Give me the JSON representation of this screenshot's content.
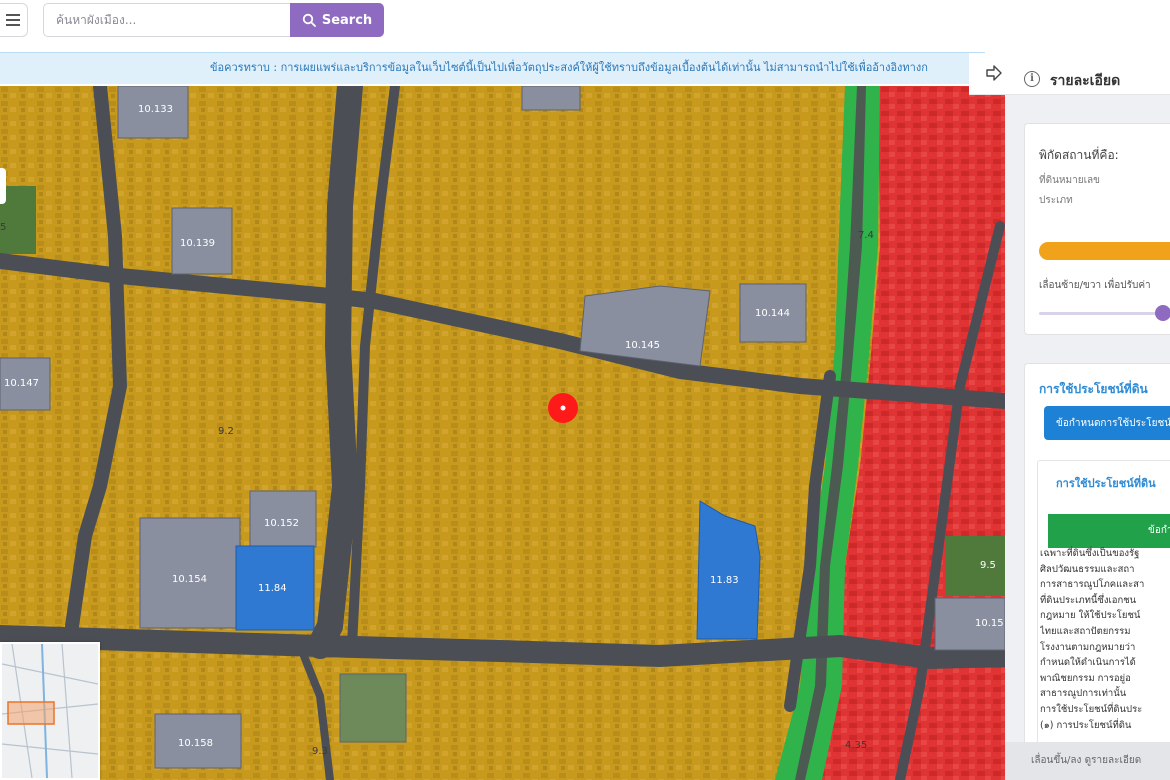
{
  "toolbar": {
    "menu_icon": "hamburger-icon",
    "search_placeholder": "ค้นหาผังเมือง...",
    "search_label": "Search",
    "search_icon": "search-icon"
  },
  "notice": {
    "text": "ข้อควรทราบ : การเผยแพร่และบริการข้อมูลในเว็บไซต์นี้เป็นไปเพื่อวัตถุประสงค์ให้ผู้ใช้ทราบถึงข้อมูลเบื้องต้นได้เท่านั้น ไม่สามารถนำไปใช้เพื่ออ้างอิงทางก"
  },
  "map": {
    "zone_colors": {
      "residential_dense": "#c79a1e",
      "commercial": "#e03333",
      "green_belt": "#2fb34a",
      "government": "#8a8fa0",
      "institutional": "#2f79d2",
      "park": "#4f7a3b"
    },
    "marker_color": "#ff1a1a",
    "parcel_labels": [
      "10.133",
      "10.139",
      "10.145",
      "10.144",
      "10.147",
      "10.152",
      "10.154",
      "11.84",
      "11.83",
      "10.158",
      "10.15",
      "9.5"
    ],
    "zone_labels": [
      "9.2",
      "9.3",
      "7.4",
      "4.35",
      "5"
    ]
  },
  "panel": {
    "title": "รายละเอียด",
    "collapse_icon": "arrow-right-icon",
    "info_icon": "info-icon",
    "location": {
      "title": "พิกัดสถานที่คือ:",
      "parcel_label": "ที่ดินหมายเลข",
      "type_label": "ประเภท",
      "bar_color": "#f0a21a",
      "slider_hint": "เลื่อนซ้าย/ขวา เพื่อปรับค่า",
      "slider_value": 0.8
    },
    "land_use": {
      "heading": "การใช้ประโยชน์ที่ดิน",
      "rules_button": "ข้อกำหนดการใช้ประโยชน์",
      "sub_title": "การใช้ประโยชน์ที่ดิน",
      "green_header": "ข้อกำ",
      "body_lines": [
        "เฉพาะที่ดินซึ่งเป็นของรัฐ",
        "ศิลปวัฒนธรรมและสถา",
        "การสาธารณูปโภคและสา",
        "ที่ดินประเภทนี้ซึ่งเอกชน",
        "กฎหมาย ให้ใช้ประโยชน์",
        "ไทยและสถาปัตยกรรม",
        "โรงงานตามกฎหมายว่า",
        "กำหนดให้ดำเนินการได้",
        "พาณิชยกรรม การอยู่อ",
        "สาธารณูปการเท่านั้น",
        "การใช้ประโยชน์ที่ดินประ",
        "(๑) การประโยชน์ที่ดิน"
      ]
    },
    "footer": "เลื่อนขึ้น/ลง ดูรายละเอียด"
  }
}
